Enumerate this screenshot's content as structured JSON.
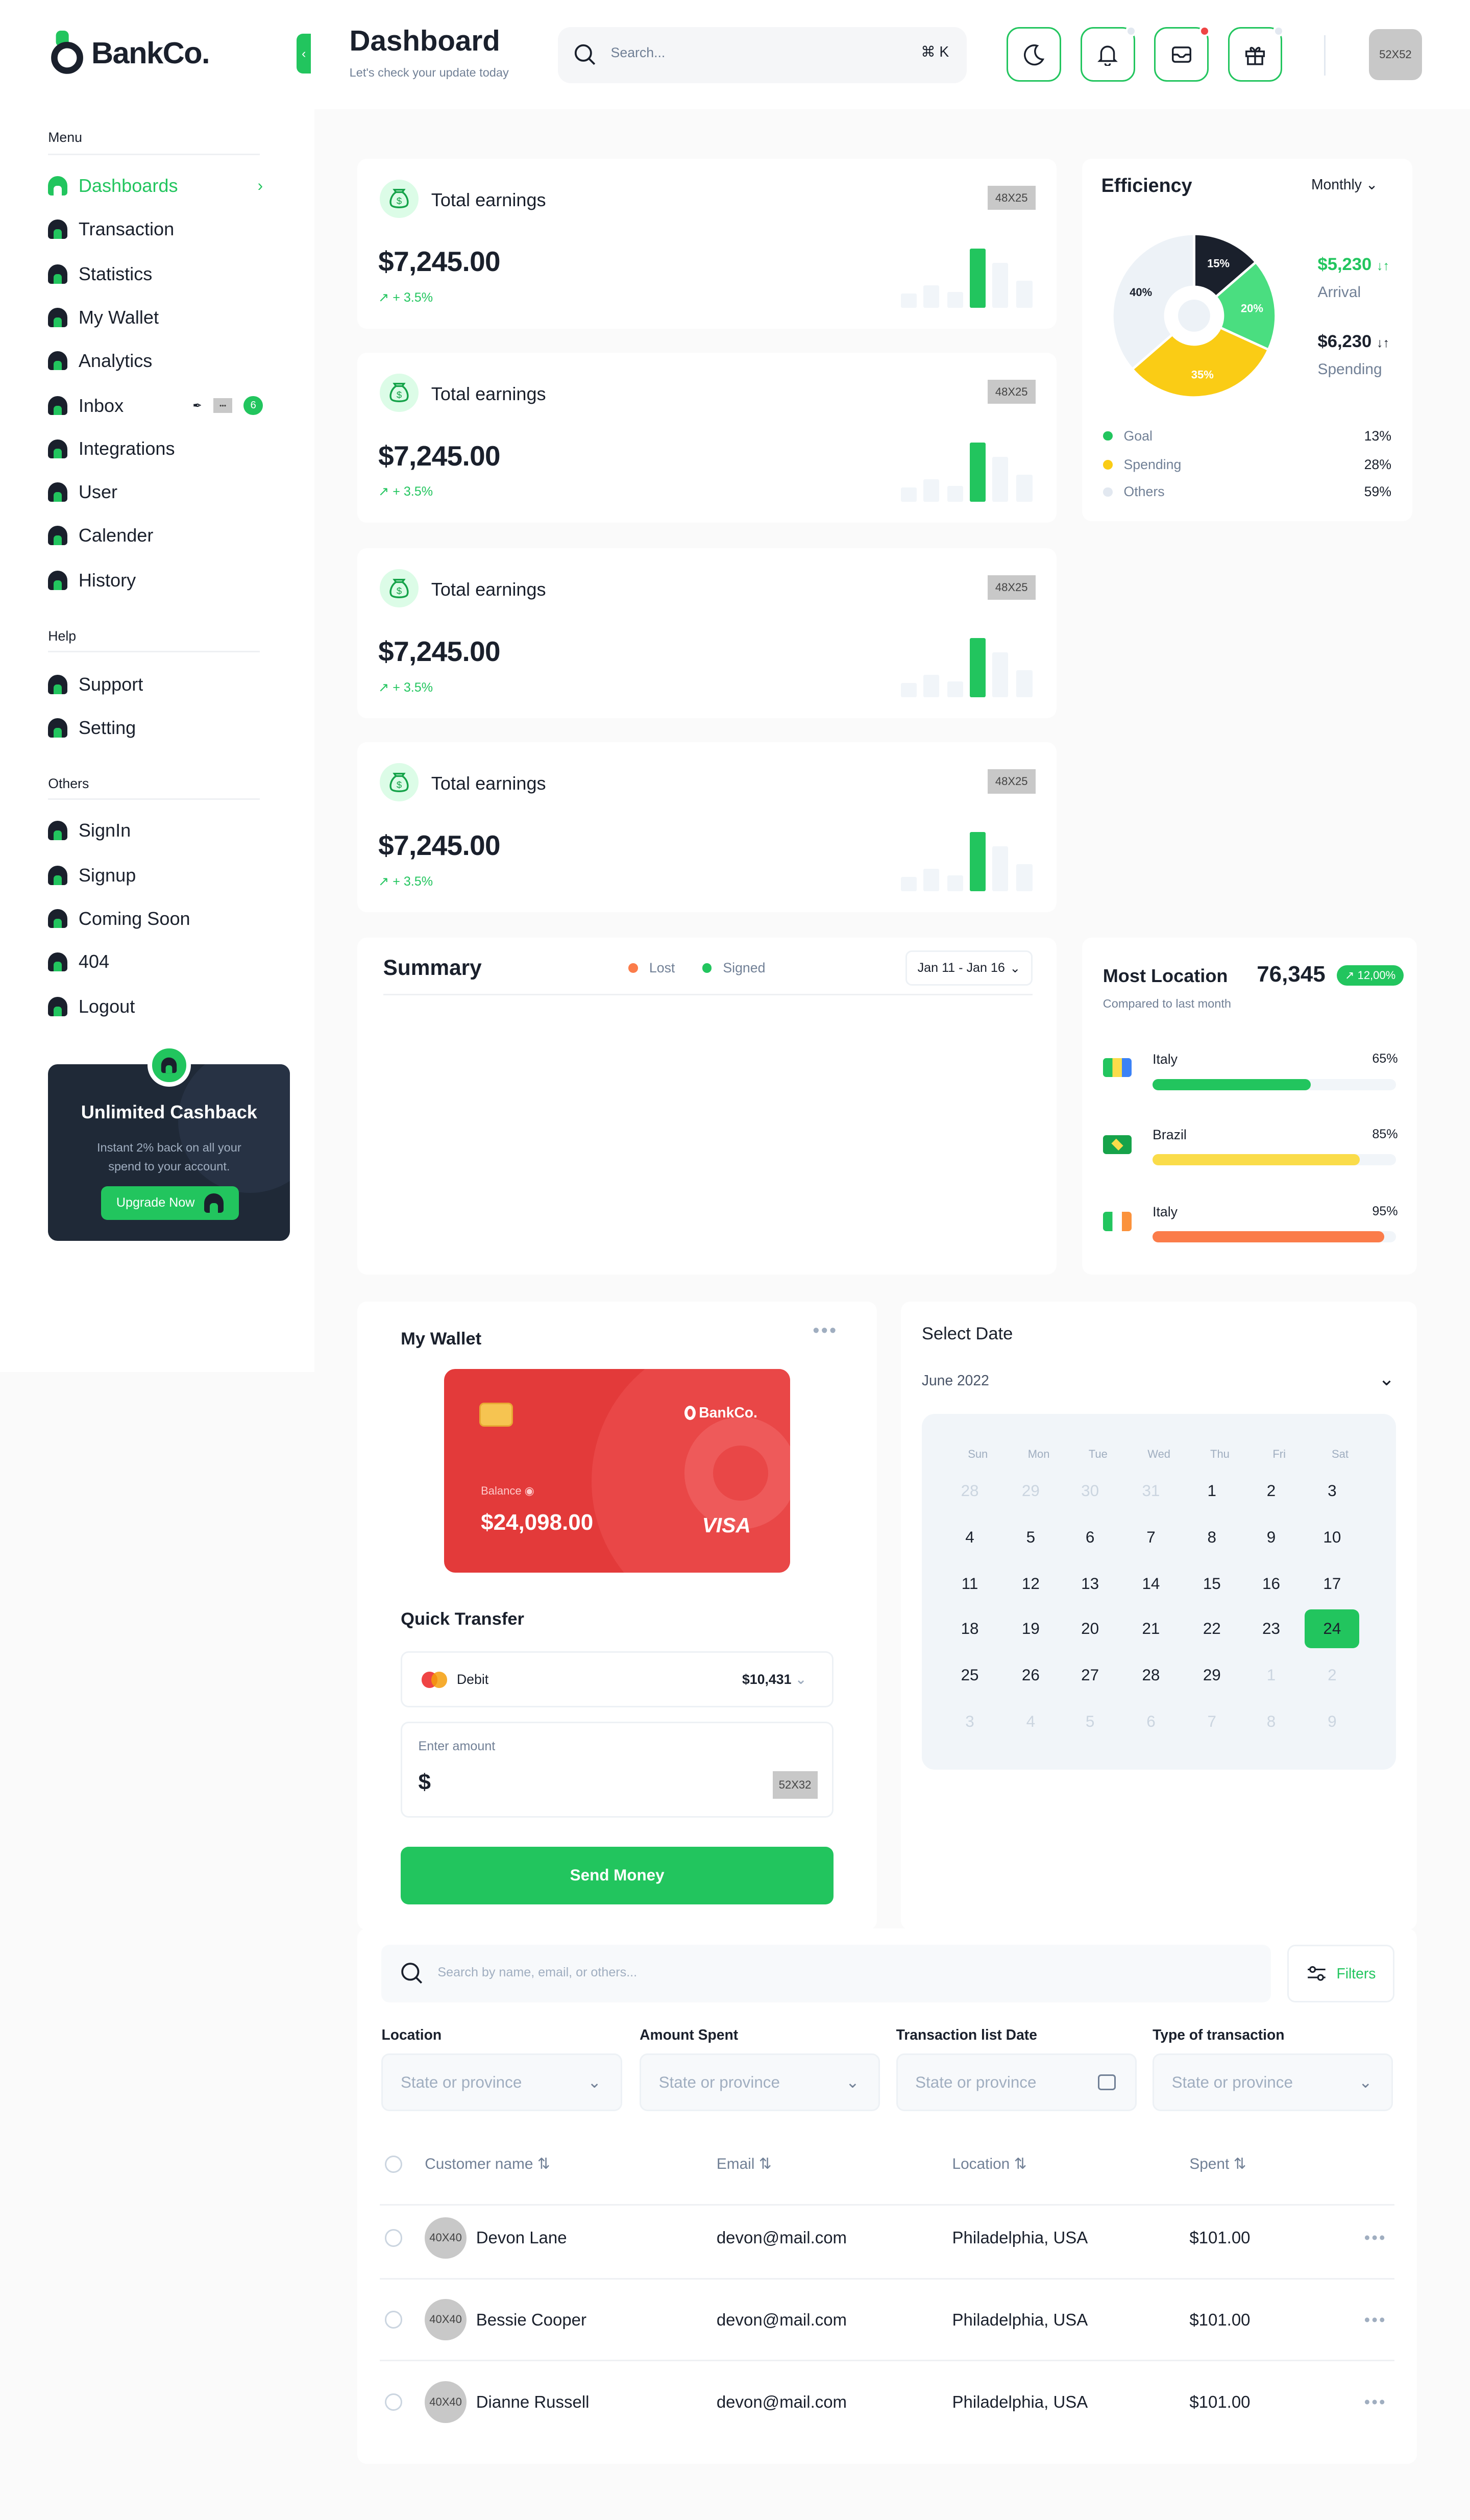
{
  "brand": {
    "name": "BankCo.",
    "accent": "#22c55e",
    "dark": "#1a202c"
  },
  "header": {
    "title": "Dashboard",
    "subtitle": "Let's check your update today",
    "search_placeholder": "Search...",
    "shortcut": "⌘ K",
    "avatar": "52X52"
  },
  "sidebar": {
    "menu_label": "Menu",
    "menu": [
      {
        "label": "Dashboards",
        "active": true
      },
      {
        "label": "Transaction"
      },
      {
        "label": "Statistics"
      },
      {
        "label": "My Wallet"
      },
      {
        "label": "Analytics"
      },
      {
        "label": "Inbox",
        "badge": "6"
      },
      {
        "label": "Integrations"
      },
      {
        "label": "User"
      },
      {
        "label": "Calender"
      },
      {
        "label": "History"
      }
    ],
    "help_label": "Help",
    "help": [
      {
        "label": "Support"
      },
      {
        "label": "Setting"
      }
    ],
    "others_label": "Others",
    "others": [
      {
        "label": "SignIn"
      },
      {
        "label": "Signup"
      },
      {
        "label": "Coming Soon"
      },
      {
        "label": "404"
      },
      {
        "label": "Logout"
      }
    ],
    "promo": {
      "title": "Unlimited Cashback",
      "text_1": "Instant 2% back on all your",
      "text_2": "spend to your account.",
      "button": "Upgrade Now"
    }
  },
  "earnings": [
    {
      "title": "Total earnings",
      "value": "$7,245.00",
      "change": "+ 3.5%",
      "badge": "48X25"
    },
    {
      "title": "Total earnings",
      "value": "$7,245.00",
      "change": "+ 3.5%",
      "badge": "48X25"
    },
    {
      "title": "Total earnings",
      "value": "$7,245.00",
      "change": "+ 3.5%",
      "badge": "48X25"
    },
    {
      "title": "Total earnings",
      "value": "$7,245.00",
      "change": "+ 3.5%",
      "badge": "48X25"
    }
  ],
  "efficiency": {
    "title": "Efficiency",
    "period": "Monthly",
    "arrival_value": "$5,230",
    "arrival_label": "Arrival",
    "spending_value": "$6,230",
    "spending_label": "Spending",
    "chart_data": {
      "type": "pie",
      "values": [
        15,
        20,
        35,
        40
      ],
      "labels": [
        "15%",
        "20%",
        "35%",
        "40%"
      ],
      "colors": [
        "#1a202c",
        "#4ade80",
        "#facc15",
        "#edf2f7"
      ]
    },
    "legend": [
      {
        "label": "Goal",
        "value": "13%",
        "color": "#22c55e"
      },
      {
        "label": "Spending",
        "value": "28%",
        "color": "#facc15"
      },
      {
        "label": "Others",
        "value": "59%",
        "color": "#e2e8f0"
      }
    ]
  },
  "summary": {
    "title": "Summary",
    "legend_lost": "Lost",
    "legend_signed": "Signed",
    "range": "Jan 11 - Jan 16",
    "lost_color": "#fb7c4a",
    "signed_color": "#22c55e"
  },
  "location": {
    "title": "Most Location",
    "total": "76,345",
    "change": "12,00%",
    "compare": "Compared to last month",
    "items": [
      {
        "name": "Italy",
        "percent": "65%",
        "value": 65,
        "color": "#22c55e"
      },
      {
        "name": "Brazil",
        "percent": "85%",
        "value": 85,
        "color": "#fadc4a"
      },
      {
        "name": "Italy",
        "percent": "95%",
        "value": 95,
        "color": "#fb7c4a"
      }
    ]
  },
  "wallet": {
    "title": "My Wallet",
    "card_brand": "BankCo.",
    "balance_label": "Balance",
    "balance": "$24,098.00",
    "network": "VISA",
    "transfer_title": "Quick Transfer",
    "debit_label": "Debit",
    "debit_amount": "$10,431",
    "amount_label": "Enter amount",
    "currency": "$",
    "amount_badge": "52X32",
    "send": "Send Money"
  },
  "calendar": {
    "title": "Select Date",
    "month": "June 2022",
    "weekdays": [
      "Sun",
      "Mon",
      "Tue",
      "Wed",
      "Thu",
      "Fri",
      "Sat"
    ],
    "days": [
      "28",
      "29",
      "30",
      "31",
      "1",
      "2",
      "3",
      "4",
      "5",
      "6",
      "7",
      "8",
      "9",
      "10",
      "11",
      "12",
      "13",
      "14",
      "15",
      "16",
      "17",
      "18",
      "19",
      "20",
      "21",
      "22",
      "23",
      "24",
      "25",
      "26",
      "27",
      "28",
      "29",
      "1",
      "2",
      "3",
      "4",
      "5",
      "6",
      "7",
      "8",
      "9"
    ]
  },
  "table": {
    "search_placeholder": "Search by name, email, or others...",
    "filters": "Filters",
    "filter_fields": [
      {
        "label": "Location",
        "placeholder": "State or province"
      },
      {
        "label": "Amount Spent",
        "placeholder": "State or province"
      },
      {
        "label": "Transaction list Date",
        "placeholder": "State or province"
      },
      {
        "label": "Type of transaction",
        "placeholder": "State or province"
      }
    ],
    "columns": [
      "Customer name",
      "Email",
      "Location",
      "Spent"
    ],
    "rows": [
      {
        "avatar": "40X40",
        "name": "Devon Lane",
        "email": "devon@mail.com",
        "location": "Philadelphia, USA",
        "spent": "$101.00"
      },
      {
        "avatar": "40X40",
        "name": "Bessie Cooper",
        "email": "devon@mail.com",
        "location": "Philadelphia, USA",
        "spent": "$101.00"
      },
      {
        "avatar": "40X40",
        "name": "Dianne Russell",
        "email": "devon@mail.com",
        "location": "Philadelphia, USA",
        "spent": "$101.00"
      }
    ]
  }
}
